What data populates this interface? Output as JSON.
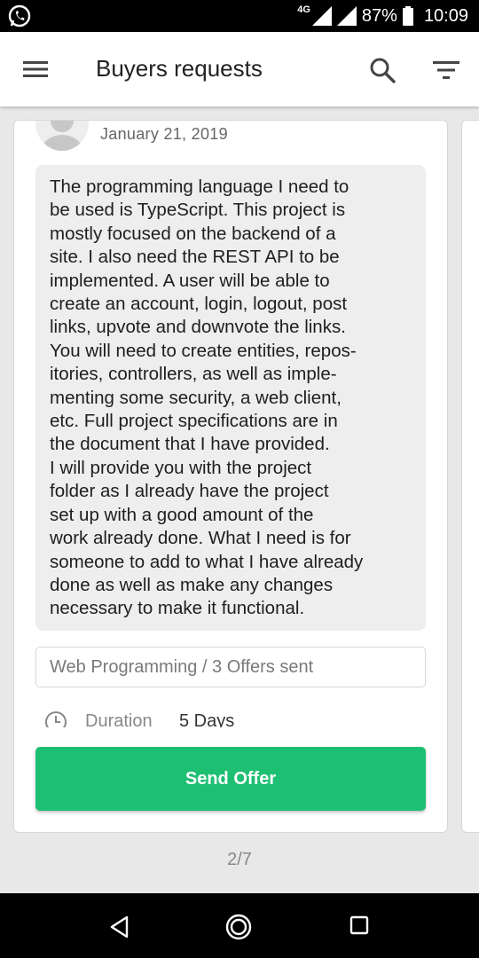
{
  "status_bar": {
    "network": "4G",
    "battery": "87%",
    "time": "10:09"
  },
  "app_bar": {
    "title": "Buyers requests"
  },
  "request": {
    "date": "January 21, 2019",
    "description_lines": [
      "The programming language I need to",
      "be used is TypeScript. This project is",
      "mostly focused on the backend of a",
      "site. I also need the REST API to be",
      "implemented. A user will be able to",
      "create an account, login, logout, post",
      "links, upvote and downvote the links.",
      "You will need to create entities, repos-",
      "itories, controllers, as well as imple-",
      "menting some security, a web client,",
      "etc. Full project specifications are in",
      "the document that I have provided.",
      "I will provide you with the project",
      "folder as I already have the project",
      "set up with a good amount of the",
      "work already done. What I need is for",
      "someone to add to what I have already",
      "done as well as make any changes",
      "necessary to make it functional."
    ],
    "category": "Web Programming / 3 Offers sent",
    "duration_label": "Duration",
    "duration_value": "5 Days",
    "send_offer_label": "Send Offer"
  },
  "pager": "2/7",
  "colors": {
    "accent": "#1dbf73",
    "background": "#e8e8e8"
  },
  "icons": {
    "status": [
      "whatsapp-icon",
      "signal-icon",
      "battery-icon"
    ],
    "app_bar": [
      "menu-icon",
      "search-icon",
      "filter-icon"
    ],
    "card": [
      "avatar-icon",
      "clock-icon"
    ],
    "nav": [
      "back-icon",
      "home-icon",
      "recent-apps-icon"
    ]
  }
}
